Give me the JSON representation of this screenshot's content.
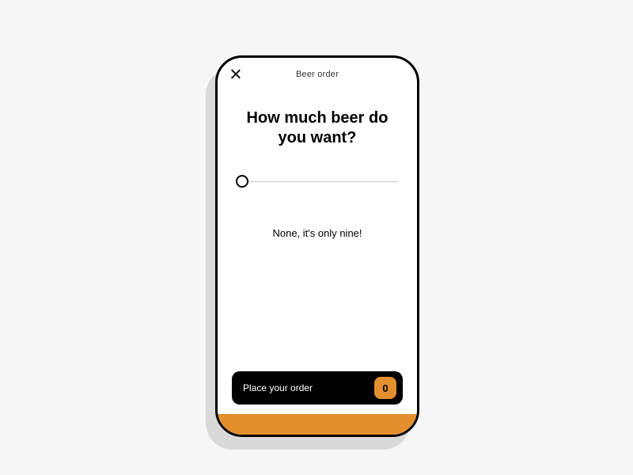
{
  "header": {
    "title": "Beer order"
  },
  "main": {
    "question": "How much beer do you want?",
    "caption": "None, it's only nine!",
    "slider": {
      "value": 0,
      "min": 0,
      "max": 10
    }
  },
  "order": {
    "button_label": "Place your order",
    "count": "0"
  },
  "colors": {
    "accent": "#e48f2d",
    "background": "#f6f6f6"
  }
}
